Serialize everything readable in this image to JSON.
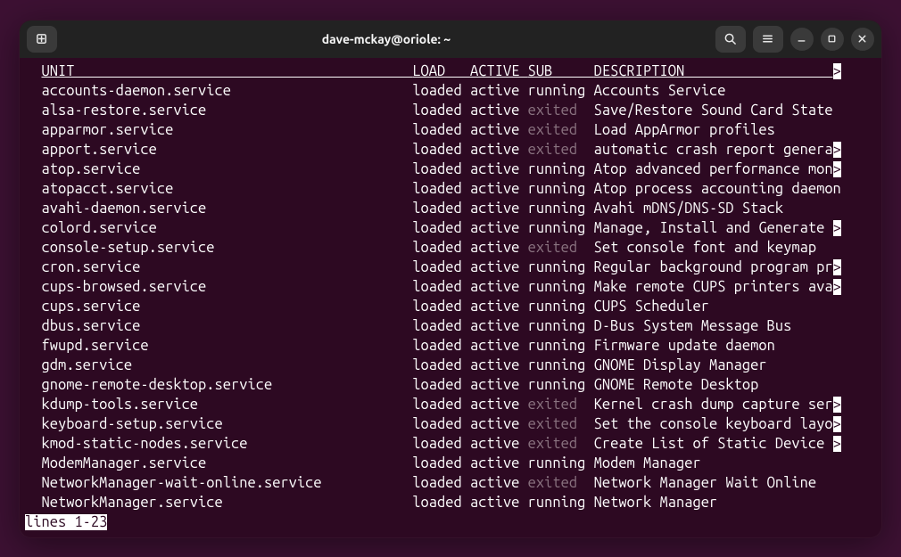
{
  "window": {
    "title": "dave-mckay@oriole: ~"
  },
  "header": {
    "unit": "UNIT",
    "load": "LOAD",
    "active": "ACTIVE",
    "sub": "SUB",
    "description": "DESCRIPTION"
  },
  "status_line": "lines 1-23",
  "col_widths": {
    "prefix": 2,
    "unit": 45,
    "load": 7,
    "active": 7,
    "sub": 8
  },
  "rows": [
    {
      "unit": "accounts-daemon.service",
      "load": "loaded",
      "active": "active",
      "sub": "running",
      "desc": "Accounts Service",
      "overflow": false
    },
    {
      "unit": "alsa-restore.service",
      "load": "loaded",
      "active": "active",
      "sub": "exited",
      "desc": "Save/Restore Sound Card State",
      "overflow": false
    },
    {
      "unit": "apparmor.service",
      "load": "loaded",
      "active": "active",
      "sub": "exited",
      "desc": "Load AppArmor profiles",
      "overflow": false
    },
    {
      "unit": "apport.service",
      "load": "loaded",
      "active": "active",
      "sub": "exited",
      "desc": "automatic crash report genera",
      "overflow": true
    },
    {
      "unit": "atop.service",
      "load": "loaded",
      "active": "active",
      "sub": "running",
      "desc": "Atop advanced performance mon",
      "overflow": true
    },
    {
      "unit": "atopacct.service",
      "load": "loaded",
      "active": "active",
      "sub": "running",
      "desc": "Atop process accounting daemon",
      "overflow": false
    },
    {
      "unit": "avahi-daemon.service",
      "load": "loaded",
      "active": "active",
      "sub": "running",
      "desc": "Avahi mDNS/DNS-SD Stack",
      "overflow": false
    },
    {
      "unit": "colord.service",
      "load": "loaded",
      "active": "active",
      "sub": "running",
      "desc": "Manage, Install and Generate ",
      "overflow": true
    },
    {
      "unit": "console-setup.service",
      "load": "loaded",
      "active": "active",
      "sub": "exited",
      "desc": "Set console font and keymap",
      "overflow": false
    },
    {
      "unit": "cron.service",
      "load": "loaded",
      "active": "active",
      "sub": "running",
      "desc": "Regular background program pr",
      "overflow": true
    },
    {
      "unit": "cups-browsed.service",
      "load": "loaded",
      "active": "active",
      "sub": "running",
      "desc": "Make remote CUPS printers ava",
      "overflow": true
    },
    {
      "unit": "cups.service",
      "load": "loaded",
      "active": "active",
      "sub": "running",
      "desc": "CUPS Scheduler",
      "overflow": false
    },
    {
      "unit": "dbus.service",
      "load": "loaded",
      "active": "active",
      "sub": "running",
      "desc": "D-Bus System Message Bus",
      "overflow": false
    },
    {
      "unit": "fwupd.service",
      "load": "loaded",
      "active": "active",
      "sub": "running",
      "desc": "Firmware update daemon",
      "overflow": false
    },
    {
      "unit": "gdm.service",
      "load": "loaded",
      "active": "active",
      "sub": "running",
      "desc": "GNOME Display Manager",
      "overflow": false
    },
    {
      "unit": "gnome-remote-desktop.service",
      "load": "loaded",
      "active": "active",
      "sub": "running",
      "desc": "GNOME Remote Desktop",
      "overflow": false
    },
    {
      "unit": "kdump-tools.service",
      "load": "loaded",
      "active": "active",
      "sub": "exited",
      "desc": "Kernel crash dump capture ser",
      "overflow": true
    },
    {
      "unit": "keyboard-setup.service",
      "load": "loaded",
      "active": "active",
      "sub": "exited",
      "desc": "Set the console keyboard layo",
      "overflow": true
    },
    {
      "unit": "kmod-static-nodes.service",
      "load": "loaded",
      "active": "active",
      "sub": "exited",
      "desc": "Create List of Static Device ",
      "overflow": true
    },
    {
      "unit": "ModemManager.service",
      "load": "loaded",
      "active": "active",
      "sub": "running",
      "desc": "Modem Manager",
      "overflow": false
    },
    {
      "unit": "NetworkManager-wait-online.service",
      "load": "loaded",
      "active": "active",
      "sub": "exited",
      "desc": "Network Manager Wait Online",
      "overflow": false
    },
    {
      "unit": "NetworkManager.service",
      "load": "loaded",
      "active": "active",
      "sub": "running",
      "desc": "Network Manager",
      "overflow": false
    }
  ]
}
